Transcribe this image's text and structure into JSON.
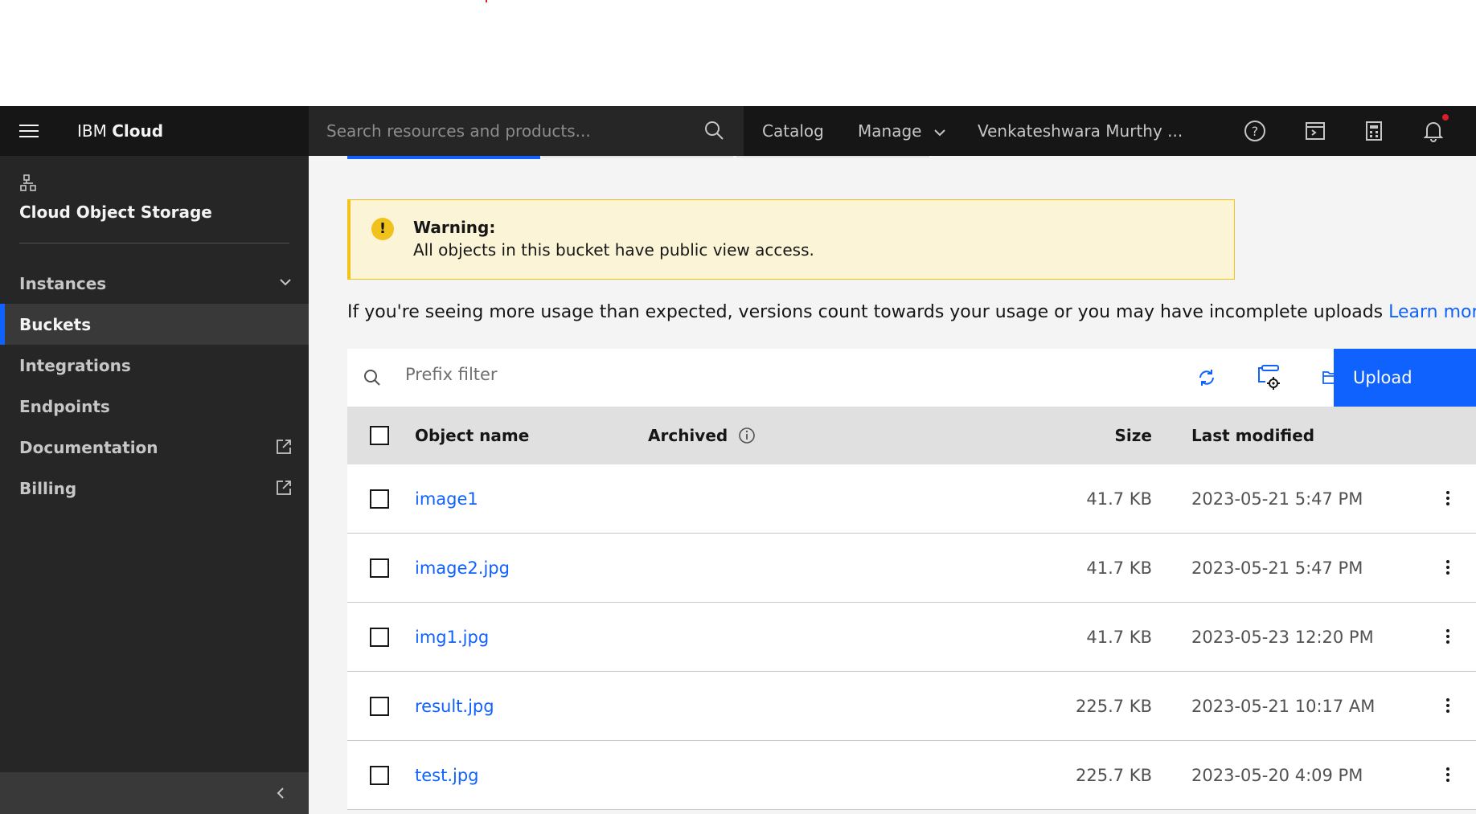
{
  "header": {
    "brand_prefix": "IBM",
    "brand_bold": "Cloud",
    "search_placeholder": "Search resources and products...",
    "nav": {
      "catalog": "Catalog",
      "manage": "Manage",
      "account": "Venkateshwara Murthy ..."
    }
  },
  "sidebar": {
    "title": "Cloud Object Storage",
    "items": [
      {
        "label": "Instances"
      },
      {
        "label": "Buckets"
      },
      {
        "label": "Integrations"
      },
      {
        "label": "Endpoints"
      },
      {
        "label": "Documentation"
      },
      {
        "label": "Billing"
      }
    ]
  },
  "warning": {
    "title": "Warning:",
    "text": "All objects in this bucket have public view access."
  },
  "usage_notice": {
    "text": "If you're seeing more usage than expected, versions count towards your usage or you may have incomplete uploads",
    "link": "Learn more"
  },
  "toolbar": {
    "filter_placeholder": "Prefix filter",
    "upload_label": "Upload"
  },
  "table": {
    "headers": {
      "name": "Object name",
      "archived": "Archived",
      "size": "Size",
      "modified": "Last modified"
    },
    "rows": [
      {
        "name": "image1",
        "size": "41.7 KB",
        "modified": "2023-05-21 5:47 PM"
      },
      {
        "name": "image2.jpg",
        "size": "41.7 KB",
        "modified": "2023-05-21 5:47 PM"
      },
      {
        "name": "img1.jpg",
        "size": "41.7 KB",
        "modified": "2023-05-23 12:20 PM"
      },
      {
        "name": "result.jpg",
        "size": "225.7 KB",
        "modified": "2023-05-21 10:17 AM"
      },
      {
        "name": "test.jpg",
        "size": "225.7 KB",
        "modified": "2023-05-20 4:09 PM"
      }
    ]
  },
  "colors": {
    "accent": "#0f62fe",
    "warning": "#f1c21b",
    "header_bg": "#161616",
    "sidebar_bg": "#262626"
  }
}
